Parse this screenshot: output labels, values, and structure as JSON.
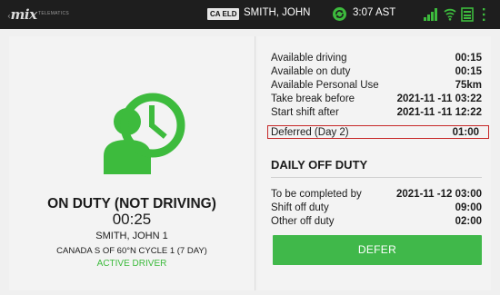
{
  "status_bar": {
    "logo_text": "mix",
    "logo_sub": "TELEMATICS",
    "eld_badge": "CA ELD",
    "driver_name": "SMITH, JOHN",
    "time": "3:07 AST",
    "icons": [
      "sync-icon",
      "signal-icon",
      "wifi-icon",
      "battery-icon",
      "menu-icon"
    ]
  },
  "left_panel": {
    "status_title": "ON DUTY (NOT DRIVING)",
    "timer": "00:25",
    "driver": "SMITH, JOHN 1",
    "cycle": "CANADA S OF 60°N CYCLE 1 (7 DAY)",
    "active_status": "ACTIVE DRIVER",
    "icon": "driver-clock-icon"
  },
  "availability": [
    {
      "label": "Available driving",
      "value": "00:15"
    },
    {
      "label": "Available on duty",
      "value": "00:15"
    },
    {
      "label": "Available Personal Use",
      "value": "75km"
    },
    {
      "label": "Take break before",
      "value": "2021-11 -11  03:22"
    },
    {
      "label": "Start shift after",
      "value": "2021-11 -11  12:22"
    }
  ],
  "deferred": {
    "label": "Deferred (Day 2)",
    "value": "01:00"
  },
  "daily_off_duty": {
    "title": "DAILY OFF DUTY",
    "rows": [
      {
        "label": "To be completed by",
        "value": "2021-11 -12  03:00"
      },
      {
        "label": "Shift off duty",
        "value": "09:00"
      },
      {
        "label": "Other off duty",
        "value": "02:00"
      }
    ]
  },
  "defer_button": {
    "label": "DEFER"
  },
  "colors": {
    "status_bar": "#1e1e1e",
    "accent_green": "#40b84a",
    "highlight_red": "#c62828",
    "panel_bg": "#f3f3f3"
  }
}
